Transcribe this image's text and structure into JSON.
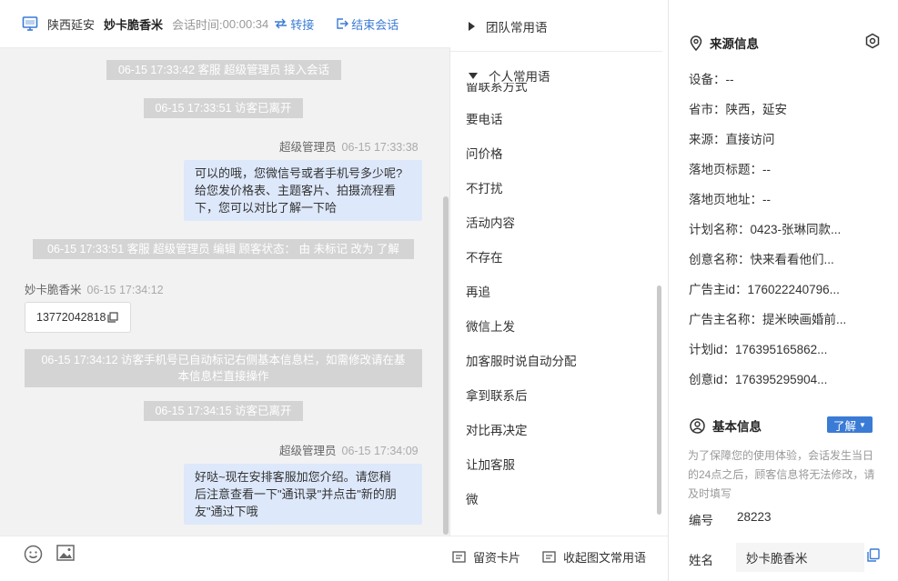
{
  "header": {
    "region": "陕西延安",
    "visitor": "妙卡脆香米",
    "session_time_label": "会话时间:",
    "session_time": "00:00:34",
    "transfer_label": "转接",
    "end_label": "结束会话"
  },
  "messages": {
    "sys1": "06-15 17:33:42 客服 超级管理员 接入会话",
    "sys2": "06-15 17:33:51 访客已离开",
    "agent1_name": "超级管理员",
    "agent1_time": "06-15 17:33:38",
    "agent1_lines": [
      "可以的哦，您微信号或者手机号多少呢?",
      "给您发价格表、主题客片、拍摄流程看",
      "下，您可以对比了解一下哈"
    ],
    "sys3": "06-15 17:33:51 客服 超级管理员 编辑 顾客状态： 由 未标记 改为 了解",
    "visitor_name": "妙卡脆香米",
    "visitor_time": "06-15 17:34:12",
    "visitor_phone": "13772042818",
    "sys4_lines": [
      "06-15 17:34:12 访客手机号已自动标记右侧基本信息栏，如需修改请在基",
      "本信息栏直接操作"
    ],
    "sys5": "06-15 17:34:15 访客已离开",
    "agent2_name": "超级管理员",
    "agent2_time": "06-15 17:34:09",
    "agent2_lines": [
      "好哒~现在安排客服加您介绍。请您稍",
      "后注意查看一下\"通讯录\"并点击\"新的朋",
      "友\"通过下哦"
    ]
  },
  "phrases": {
    "team_label": "团队常用语",
    "personal_label": "个人常用语",
    "cut_item": "留联系方式",
    "items": [
      "要电话",
      "问价格",
      "不打扰",
      "活动内容",
      "不存在",
      "再追",
      "微信上发",
      "加客服时说自动分配",
      "拿到联系后",
      "对比再决定",
      "让加客服",
      "微"
    ],
    "card_label": "留资卡片",
    "collapse_label": "收起图文常用语"
  },
  "info": {
    "source_title": "来源信息",
    "rows": [
      "设备：--",
      "省市：陕西，延安",
      "来源：直接访问",
      "落地页标题：--",
      "落地页地址：--",
      "计划名称：0423-张琳同款...",
      "创意名称：快来看看他们...",
      "广告主id：176022240796...",
      "广告主名称：提米映画婚前...",
      "计划id：176395165862...",
      "创意id：176395295904..."
    ],
    "basic_title": "基本信息",
    "know_label": "了解",
    "notice": "为了保障您的使用体验，会话发生当日的24点之后，顾客信息将无法修改，请及时填写",
    "number_label": "编号",
    "number_value": "28223",
    "name_label": "姓名",
    "name_value": "妙卡脆香米"
  },
  "colors": {
    "accent": "#3a7bd5",
    "bubble": "#dde8fb",
    "system_bubble": "#d4d4d4"
  }
}
